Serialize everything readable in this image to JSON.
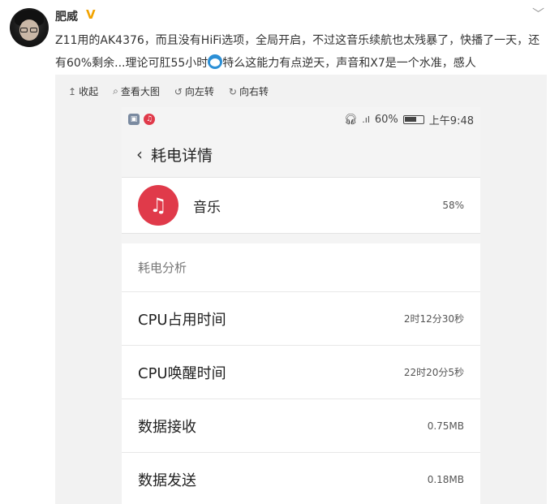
{
  "user": {
    "name": "肥威",
    "verified_icon": "verified-v-icon"
  },
  "post": {
    "text_before_emoji": "Z11用的AK4376，而且没有HiFi选项，全局开启，不过这音乐续航也太残暴了，快播了一天，还有60%剩余...理论可肛55小时",
    "text_after_emoji": "特么这能力有点逆天，声音和X7是一个水准，感人"
  },
  "toolbar": [
    {
      "icon": "collapse-icon",
      "glyph": "↥",
      "label": "收起"
    },
    {
      "icon": "search-icon",
      "glyph": "⌕",
      "label": "查看大图"
    },
    {
      "icon": "rotate-left-icon",
      "glyph": "↺",
      "label": "向左转"
    },
    {
      "icon": "rotate-right-icon",
      "glyph": "↻",
      "label": "向右转"
    }
  ],
  "phone": {
    "status": {
      "battery": "60%",
      "time": "上午9:48"
    },
    "title": "耗电详情",
    "app": {
      "name": "音乐",
      "percent": "58%"
    },
    "section_title": "耗电分析",
    "stats": [
      {
        "label": "CPU占用时间",
        "value": "2时12分30秒"
      },
      {
        "label": "CPU唤醒时间",
        "value": "22时20分5秒"
      },
      {
        "label": "数据接收",
        "value": "0.75MB"
      },
      {
        "label": "数据发送",
        "value": "0.18MB"
      }
    ]
  },
  "colors": {
    "accent_red": "#e03a4a",
    "verify_gold": "#f2a300"
  }
}
